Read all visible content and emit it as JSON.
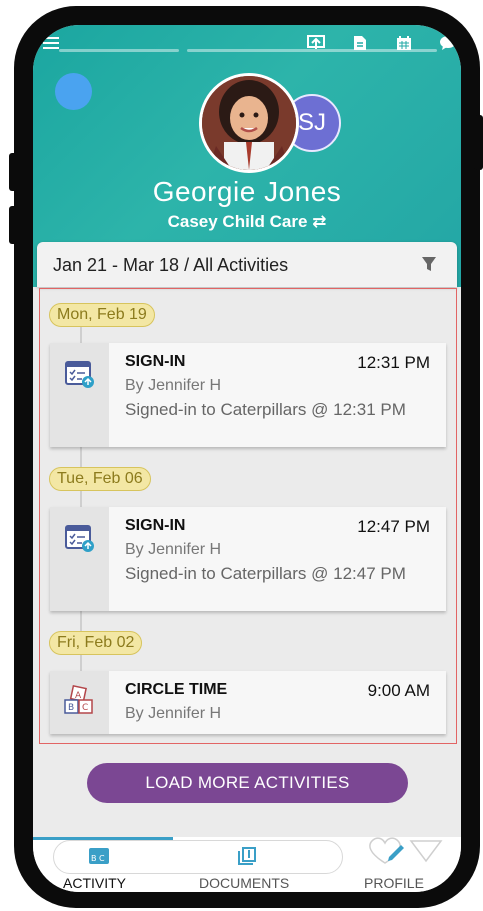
{
  "header": {
    "child_name": "Georgie Jones",
    "center_name": "Casey Child Care ⇄",
    "avatar_initials": "SJ",
    "icons": [
      "menu-icon",
      "share-icon",
      "document-icon",
      "calendar-icon",
      "chat-icon"
    ]
  },
  "filter": {
    "label": "Jan 21 - Mar 18 / All Activities",
    "icon": "filter-icon"
  },
  "groups": [
    {
      "date": "Mon, Feb 19",
      "activity": {
        "icon": "sign-in-calendar-icon",
        "title": "SIGN-IN",
        "time": "12:31 PM",
        "by": "By Jennifer H",
        "description": "Signed-in to Caterpillars @ 12:31 PM"
      }
    },
    {
      "date": "Tue, Feb 06",
      "activity": {
        "icon": "sign-in-calendar-icon",
        "title": "SIGN-IN",
        "time": "12:47 PM",
        "by": "By Jennifer H",
        "description": "Signed-in to Caterpillars @ 12:47 PM"
      }
    },
    {
      "date": "Fri, Feb 02",
      "activity": {
        "icon": "abc-blocks-icon",
        "title": "CIRCLE TIME",
        "time": "9:00 AM",
        "by": "By Jennifer H",
        "description": ""
      }
    }
  ],
  "load_more": "LOAD MORE ACTIVITIES",
  "tabs": [
    {
      "label": "ACTIVITY",
      "icon": "abc-icon",
      "active": true
    },
    {
      "label": "DOCUMENTS",
      "icon": "documents-icon",
      "active": false
    },
    {
      "label": "PROFILE",
      "icon": "heart-pencil-icon",
      "active": false
    }
  ],
  "colors": {
    "header_teal": "#23aaa5",
    "date_pill": "#f3e7a4",
    "button_purple": "#7b4793",
    "tab_indicator": "#3a9fc7"
  }
}
